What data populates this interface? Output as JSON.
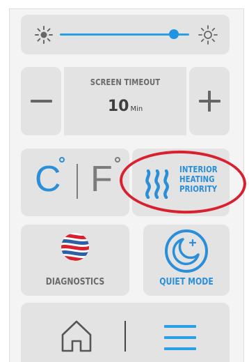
{
  "brightness": {
    "low_icon": "sun-dim-icon",
    "high_icon": "sun-bright-icon",
    "level": 0.88
  },
  "screen_timeout": {
    "label": "SCREEN TIMEOUT",
    "value": "10",
    "unit": "Min",
    "decrease_icon": "minus-icon",
    "increase_icon": "plus-icon"
  },
  "temperature_unit": {
    "celsius": "C",
    "fahrenheit": "F",
    "selected": "C"
  },
  "heating_priority": {
    "line1": "INTERIOR",
    "line2": "HEATING",
    "line3": "PRIORITY",
    "icon": "heat-waves-icon"
  },
  "diagnostics": {
    "label": "DIAGNOSTICS",
    "icon": "diagnostics-globe-icon"
  },
  "quiet_mode": {
    "label": "QUIET MODE",
    "icon": "moon-icon"
  },
  "nav": {
    "home_icon": "home-icon",
    "menu_icon": "menu-icon"
  },
  "colors": {
    "accent": "#2b8fd8",
    "tile": "#e3e3e3",
    "text_gray": "#6a6a6a",
    "highlight_red": "#d8202f"
  }
}
